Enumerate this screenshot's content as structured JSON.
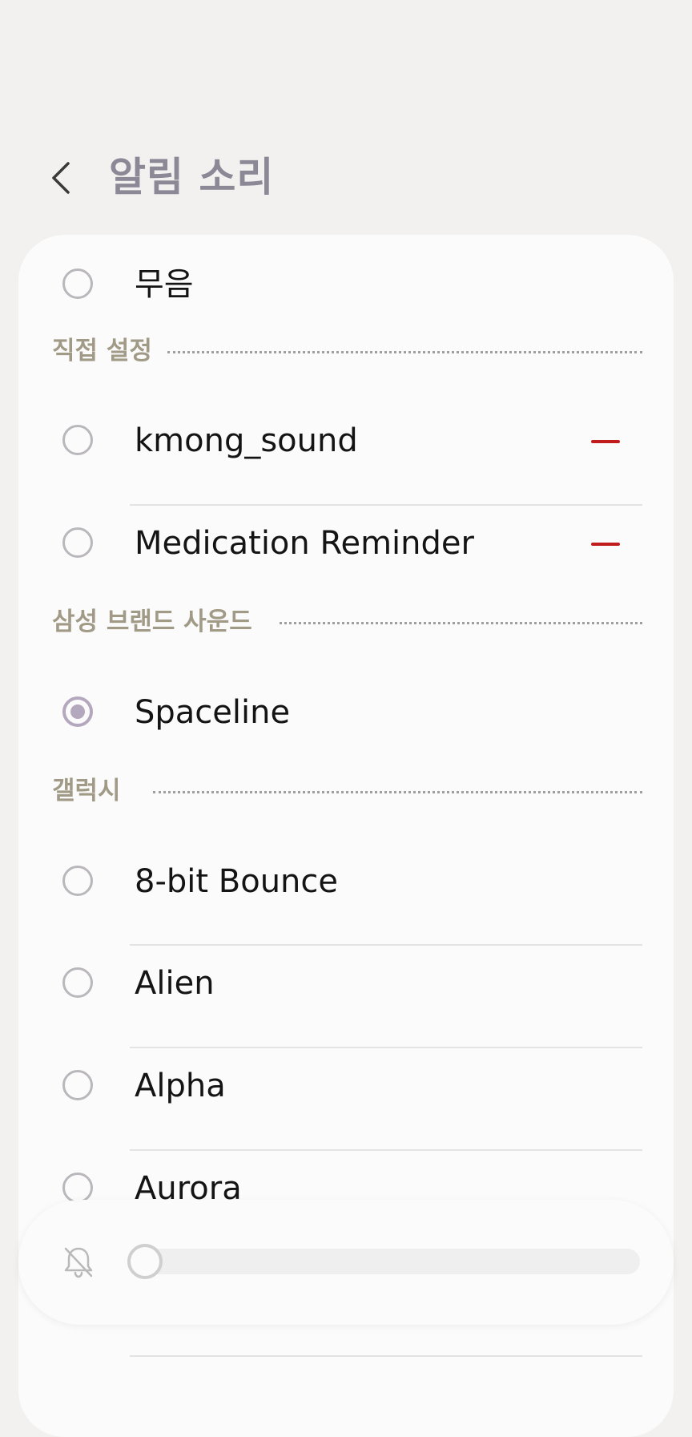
{
  "header": {
    "back_icon": "chevron-left-icon",
    "title": "알림 소리"
  },
  "items_top": [
    {
      "label": "무음",
      "selected": false
    }
  ],
  "sections": [
    {
      "title": "직접 설정",
      "items": [
        {
          "label": "kmong_sound",
          "selected": false,
          "removable": true
        },
        {
          "label": "Medication Reminder",
          "selected": false,
          "removable": true
        }
      ]
    },
    {
      "title": "삼성 브랜드 사운드",
      "items": [
        {
          "label": "Spaceline",
          "selected": true
        }
      ]
    },
    {
      "title": "갤럭시",
      "items": [
        {
          "label": "8-bit Bounce",
          "selected": false
        },
        {
          "label": "Alien",
          "selected": false
        },
        {
          "label": "Alpha",
          "selected": false
        },
        {
          "label": "Aurora",
          "selected": false
        }
      ]
    }
  ],
  "volume": {
    "icon": "bell-off-icon",
    "level": 0
  },
  "colors": {
    "background": "#f2f1f0",
    "card": "#fbfbfb",
    "title": "#8c8896",
    "section_label": "#a19a86",
    "accent_radio": "#b4a8be",
    "remove": "#c21d1d"
  }
}
